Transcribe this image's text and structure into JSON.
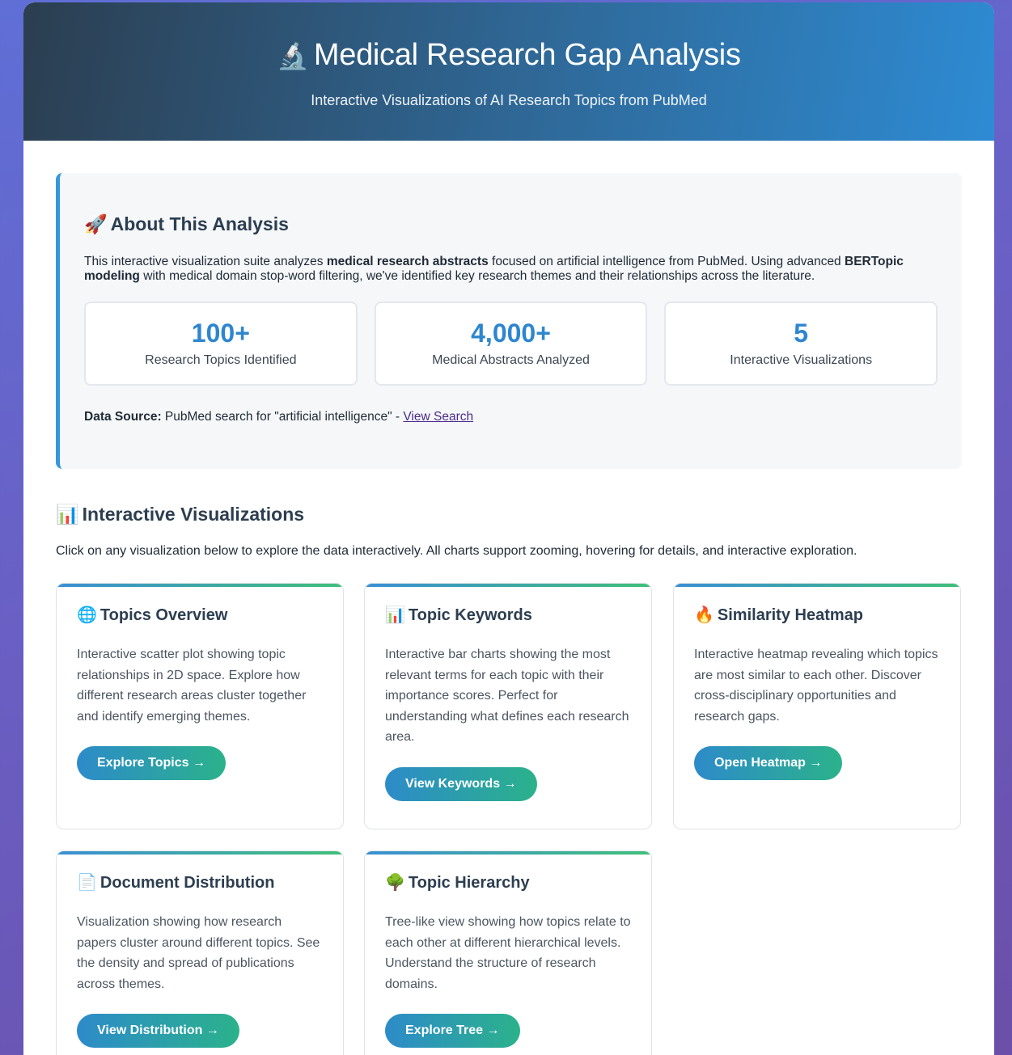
{
  "header": {
    "icon": "microscope-icon",
    "title": "Medical Research Gap Analysis",
    "subtitle": "Interactive Visualizations of AI Research Topics from PubMed"
  },
  "about": {
    "icon": "rocket-icon",
    "title": "About This Analysis",
    "desc_1": "This interactive visualization suite analyzes ",
    "desc_bold_1": "medical research abstracts",
    "desc_2": " focused on artificial intelligence from PubMed. Using advanced ",
    "desc_bold_2": "BERTopic modeling",
    "desc_3": " with medical domain stop-word filtering, we've identified key research themes and their relationships across the literature.",
    "stats": [
      {
        "value": "100+",
        "label": "Research Topics Identified"
      },
      {
        "value": "4,000+",
        "label": "Medical Abstracts Analyzed"
      },
      {
        "value": "5",
        "label": "Interactive Visualizations"
      }
    ],
    "source_label": "Data Source:",
    "source_text": " PubMed search for \"artificial intelligence\" - ",
    "source_link": "View Search"
  },
  "visualizations": {
    "icon": "bar-chart-icon",
    "title": "Interactive Visualizations",
    "desc": "Click on any visualization below to explore the data interactively. All charts support zooming, hovering for details, and interactive exploration.",
    "cards": [
      {
        "icon": "globe-icon",
        "title": "Topics Overview",
        "desc": "Interactive scatter plot showing topic relationships in 2D space. Explore how different research areas cluster together and identify emerging themes.",
        "button": "Explore Topics →"
      },
      {
        "icon": "bar-chart-icon",
        "title": "Topic Keywords",
        "desc": "Interactive bar charts showing the most relevant terms for each topic with their importance scores. Perfect for understanding what defines each research area.",
        "button": "View Keywords →"
      },
      {
        "icon": "fire-icon",
        "title": "Similarity Heatmap",
        "desc": "Interactive heatmap revealing which topics are most similar to each other. Discover cross-disciplinary opportunities and research gaps.",
        "button": "Open Heatmap →"
      },
      {
        "icon": "document-icon",
        "title": "Document Distribution",
        "desc": "Visualization showing how research papers cluster around different topics. See the density and spread of publications across themes.",
        "button": "View Distribution →"
      },
      {
        "icon": "tree-icon",
        "title": "Topic Hierarchy",
        "desc": "Tree-like view showing how topics relate to each other at different hierarchical levels. Understand the structure of research domains.",
        "button": "Explore Tree →"
      }
    ]
  }
}
